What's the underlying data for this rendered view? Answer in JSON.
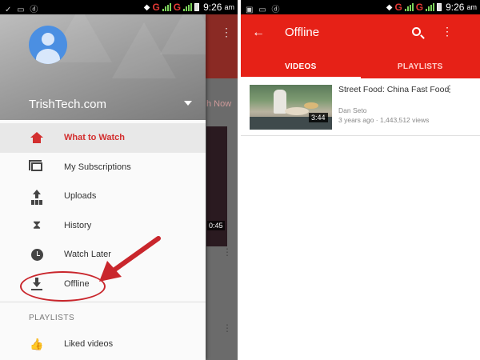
{
  "left": {
    "status": {
      "left": "✓ ▭ ⓓ",
      "network": "G",
      "network2": "G",
      "time": "9:26",
      "ampm": "am"
    },
    "background": {
      "show_now": "h Now",
      "duration": "0:45"
    },
    "account": {
      "name": "TrishTech.com"
    },
    "menu": [
      {
        "label": "What to Watch",
        "active": true
      },
      {
        "label": "My Subscriptions"
      },
      {
        "label": "Uploads"
      },
      {
        "label": "History"
      },
      {
        "label": "Watch Later"
      },
      {
        "label": "Offline"
      }
    ],
    "section": {
      "label": "PLAYLISTS"
    },
    "playlists": [
      {
        "label": "Liked videos"
      }
    ]
  },
  "right": {
    "status": {
      "left": "▣ ▭ ⓓ",
      "network": "G",
      "network2": "G",
      "time": "9:26",
      "ampm": "am"
    },
    "appbar": {
      "title": "Offline"
    },
    "tabs": [
      {
        "label": "VIDEOS",
        "active": true
      },
      {
        "label": "PLAYLISTS"
      }
    ],
    "video": {
      "title": "Street Food:  China Fast Food",
      "channel": "Dan Seto",
      "meta": "3 years ago · 1,443,512 views",
      "duration": "3:44"
    }
  },
  "colors": {
    "accent": "#e62117",
    "annotation": "#c9262c"
  }
}
